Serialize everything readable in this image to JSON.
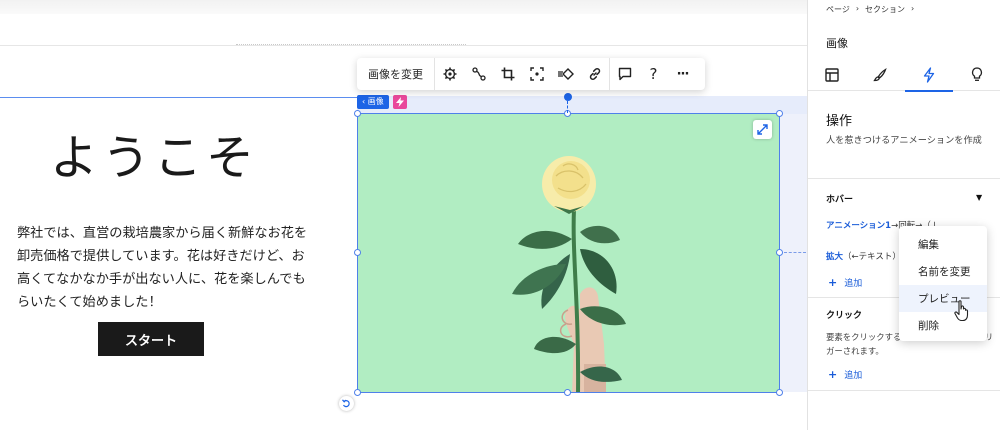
{
  "canvas": {
    "hero_title": "ようこそ",
    "hero_text": "弊社では、直営の栽培農家から届く新鮮なお花を卸売価格で提供しています。花は好きだけど、お高くてなかなか手が出ない人に、花を楽しんでもらいたくて始めました！",
    "start_button": "スタート",
    "image_tag": "‹ 画像",
    "image_bg_color": "#b1edc2",
    "selection_color": "#4f80ea"
  },
  "toolbar": {
    "change_image": "画像を変更",
    "icons": [
      "settings-icon",
      "animation-path-icon",
      "crop-icon",
      "focus-icon",
      "mask-icon",
      "link-icon",
      "comment-icon",
      "help-icon",
      "more-icon"
    ],
    "help_glyph": "?",
    "more_glyph": "···"
  },
  "panel": {
    "breadcrumb": [
      "ページ",
      "セクション"
    ],
    "title": "画像",
    "tabs": [
      "layout-icon",
      "design-icon",
      "animation-icon",
      "tips-icon"
    ],
    "active_tab": 2,
    "section_title": "操作",
    "section_desc": "人を惹きつけるアニメーションを作成",
    "hover_label": "ホバー",
    "anim1": "アニメーション1",
    "anim1_rest": "→回転→（↓",
    "anim2": "拡大",
    "anim2_rest": "（←テキスト）",
    "add_label": "追加",
    "click_label": "クリック",
    "click_desc": "要素をクリックするとアニメーションがトリガーされます。",
    "add_label2": "追加",
    "accent": "#1a5cd8"
  },
  "context_menu": {
    "items": [
      "編集",
      "名前を変更",
      "プレビュー",
      "削除"
    ],
    "hovered": 2
  }
}
